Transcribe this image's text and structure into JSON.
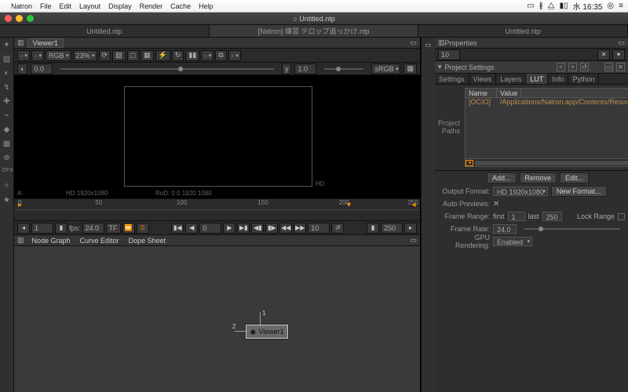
{
  "os_menu": {
    "app": "Natron",
    "items": [
      "File",
      "Edit",
      "Layout",
      "Display",
      "Render",
      "Cache",
      "Help"
    ],
    "clock": "水 16:35"
  },
  "window": {
    "title": "Untitled.ntp"
  },
  "doc_tabs": [
    "Untitled.ntp",
    "[Natron] 練習 テロップ追っかけ.ntp",
    "Untitled.ntp"
  ],
  "viewer": {
    "tab": "Viewer1",
    "layer": "-",
    "channels": "RGB",
    "zoom": "23%",
    "input_a": "-",
    "input_b": "-",
    "gain": "0.0",
    "gamma": "1.0",
    "colorspace": "sRGB",
    "format_label": "HD 1920x1080",
    "rod": "RoD: 0 0 1920 1080",
    "hd_tag": "HD",
    "a_tag": "A:"
  },
  "timeline": {
    "ticks": [
      "0",
      "50",
      "100",
      "150",
      "200",
      "250"
    ],
    "first": "1",
    "fps_label": "fps:",
    "fps": "24.0",
    "tf": "TF",
    "current": "0",
    "step": "10",
    "last": "250"
  },
  "graph_tabs": [
    "Node Graph",
    "Curve Editor",
    "Dope Sheet"
  ],
  "node": {
    "name": "Viewer1"
  },
  "props": {
    "title": "Properties",
    "count": "10",
    "section": "Project Settings",
    "tabs": [
      "Settings",
      "Views",
      "Layers",
      "LUT",
      "Info",
      "Python"
    ],
    "paths_label": "Project Paths",
    "col_name": "Name",
    "col_value": "Value",
    "row_name": "[OCIO]",
    "row_value": "/Applications/Natron.app/Contents/Resources/OpenColorIO-Co",
    "add": "Add...",
    "remove": "Remove",
    "edit": "Edit...",
    "output_format": "Output Format:",
    "output_val": "HD 1920x1080",
    "new_format": "New Format...",
    "auto_prev": "Auto Previews:",
    "frame_range": "Frame Range:",
    "first_label": "first",
    "first_val": "1",
    "last_label": "last",
    "last_val": "250",
    "lock": "Lock Range",
    "frame_rate": "Frame Rate:",
    "rate_val": "24.0",
    "gpu": "GPU Rendering:",
    "gpu_val": "Enabled"
  }
}
